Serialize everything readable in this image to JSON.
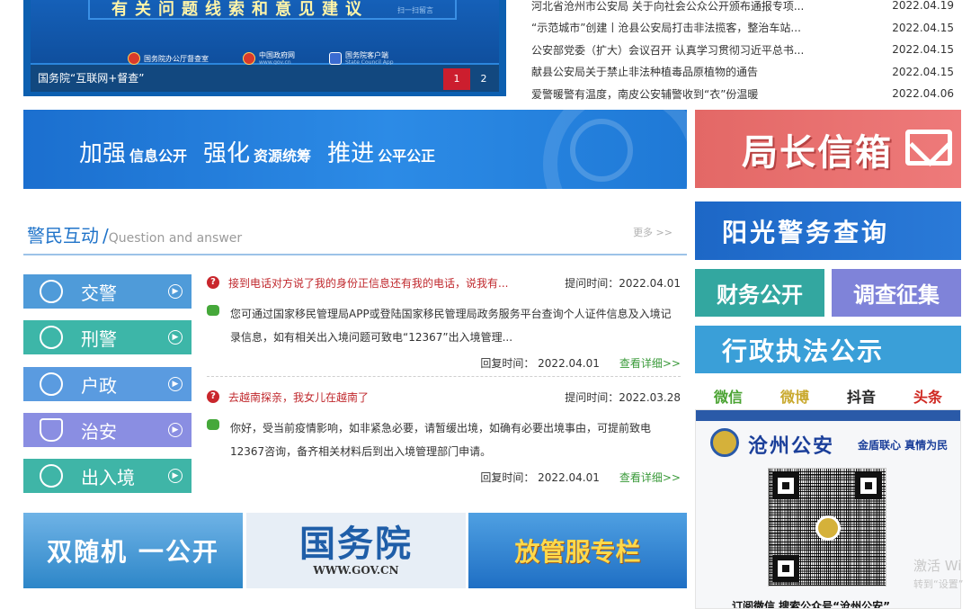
{
  "slider": {
    "headline": "有关问题线索和意见建议",
    "qr_hint": "扫一扫留言",
    "logos": [
      {
        "text": "国务院办公厅督查室",
        "sub": ""
      },
      {
        "text": "中国政府网",
        "sub": "www.gov.cn"
      },
      {
        "text": "国务院客户端",
        "sub": "State Council App"
      }
    ],
    "caption": "国务院“互联网+督查”",
    "pages": [
      "1",
      "2"
    ]
  },
  "news": [
    {
      "title": "河北省沧州市公安局 关于向社会公众公开颁布通报专项...",
      "date": "2022.04.19"
    },
    {
      "title": "“示范城市”创建丨沧县公安局打击非法揽客，整治车站...",
      "date": "2022.04.15"
    },
    {
      "title": "公安部党委（扩大）会议召开 认真学习贯彻习近平总书...",
      "date": "2022.04.15"
    },
    {
      "title": "献县公安局关于禁止非法种植毒品原植物的通告",
      "date": "2022.04.15"
    },
    {
      "title": "爱警暖警有温度，南皮公安辅警收到“衣”份温暖",
      "date": "2022.04.06"
    }
  ],
  "slogan": {
    "b1": "加强",
    "s1": "信息公开",
    "b2": "强化",
    "s2": "资源统筹",
    "b3": "推进",
    "s3": "公平公正"
  },
  "right": {
    "mailbox": "局长信箱",
    "sunshine": "阳光警务查询",
    "finance": "财务公开",
    "investigation": "调查征集",
    "law": "行政执法公示"
  },
  "social": [
    "微信",
    "微博",
    "抖音",
    "头条"
  ],
  "wechat": {
    "brand": "沧州公安",
    "slogan": "金盾联心 真情为民",
    "footer": "订阅微信    搜索公众号“沧州公安”"
  },
  "interaction": {
    "title": "警民互动",
    "sep": "/",
    "subtitle": "Question and answer",
    "more": "更多 >>",
    "categories": [
      "交警",
      "刑警",
      "户政",
      "治安",
      "出入境"
    ],
    "items": [
      {
        "question": "接到电话对方说了我的身份正信息还有我的电话，说我有...",
        "ask_time": "提问时间：2022.04.01",
        "answer": "您可通过国家移民管理局APP或登陆国家移民管理局政务服务平台查询个人证件信息及入境记录信息，如有相关出入境问题可致电“12367”出入境管理...",
        "reply_time": "回复时间： 2022.04.01",
        "detail": "查看详细>>"
      },
      {
        "question": "去越南探亲，我女儿在越南了",
        "ask_time": "提问时间：2022.03.28",
        "answer": "你好，受当前疫情影响，如非紧急必要，请暂缓出境，如确有必要出境事由，可提前致电12367咨询，备齐相关材料后到出入境管理部门申请。",
        "reply_time": "回复时间： 2022.04.01",
        "detail": "查看详细>>"
      }
    ]
  },
  "bottom": {
    "b1": "双随机 一公开",
    "b2": "国务院",
    "b2_sub": "WWW.GOV.CN",
    "b3": "放管服专栏"
  },
  "watermark": {
    "line1": "激活 Wi",
    "line2": "转到“设置”"
  },
  "icons": {
    "traffic": "police-cap-icon",
    "criminal": "badge-star-icon",
    "household": "people-icon",
    "security": "shield-icon",
    "exit_entry": "globe-icon",
    "question": "question-mark-icon",
    "answer": "chat-bubble-icon",
    "mail": "envelope-icon",
    "emblem": "police-emblem-icon"
  },
  "colors": {
    "primary_blue": "#1f73c9",
    "question_red": "#c0282d",
    "detail_green": "#3a9a3a",
    "active_page": "#cc1e2e"
  }
}
